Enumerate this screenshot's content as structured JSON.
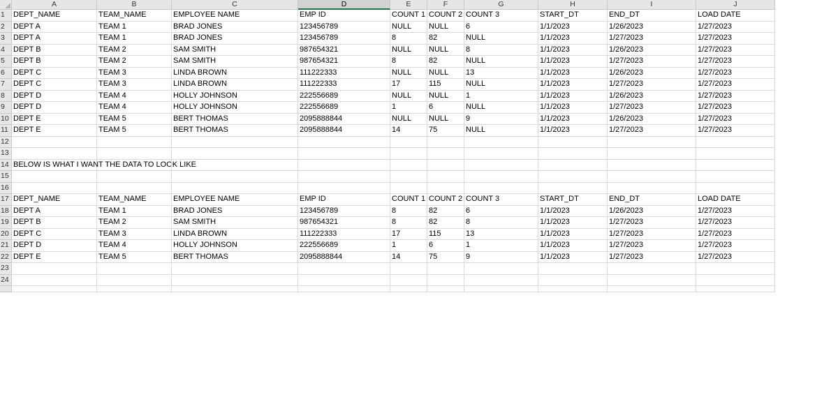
{
  "columns": [
    "A",
    "B",
    "C",
    "D",
    "E",
    "F",
    "G",
    "H",
    "I",
    "J"
  ],
  "selected_column": "D",
  "rows": [
    {
      "n": "1",
      "cells": [
        "DEPT_NAME",
        "TEAM_NAME",
        "EMPLOYEE NAME",
        "EMP ID",
        "COUNT 1",
        "COUNT 2",
        "COUNT 3",
        "START_DT",
        "END_DT",
        "LOAD DATE"
      ]
    },
    {
      "n": "2",
      "cells": [
        "DEPT A",
        "TEAM 1",
        "BRAD JONES",
        "123456789",
        "NULL",
        "NULL",
        "6",
        "1/1/2023",
        "1/26/2023",
        "1/27/2023"
      ]
    },
    {
      "n": "3",
      "cells": [
        "DEPT A",
        "TEAM 1",
        "BRAD JONES",
        "123456789",
        "8",
        "82",
        "NULL",
        "1/1/2023",
        "1/27/2023",
        "1/27/2023"
      ]
    },
    {
      "n": "4",
      "cells": [
        "DEPT B",
        "TEAM 2",
        "SAM SMITH",
        "987654321",
        "NULL",
        "NULL",
        "8",
        "1/1/2023",
        "1/26/2023",
        "1/27/2023"
      ]
    },
    {
      "n": "5",
      "cells": [
        "DEPT B",
        "TEAM 2",
        "SAM SMITH",
        "987654321",
        "8",
        "82",
        "NULL",
        "1/1/2023",
        "1/27/2023",
        "1/27/2023"
      ]
    },
    {
      "n": "6",
      "cells": [
        "DEPT C",
        "TEAM 3",
        "LINDA BROWN",
        "111222333",
        "NULL",
        "NULL",
        "13",
        "1/1/2023",
        "1/26/2023",
        "1/27/2023"
      ]
    },
    {
      "n": "7",
      "cells": [
        "DEPT C",
        "TEAM 3",
        "LINDA BROWN",
        "111222333",
        "17",
        "115",
        "NULL",
        "1/1/2023",
        "1/27/2023",
        "1/27/2023"
      ]
    },
    {
      "n": "8",
      "cells": [
        "DEPT D",
        "TEAM 4",
        "HOLLY JOHNSON",
        "222556689",
        "NULL",
        "NULL",
        "1",
        "1/1/2023",
        "1/26/2023",
        "1/27/2023"
      ]
    },
    {
      "n": "9",
      "cells": [
        "DEPT D",
        "TEAM 4",
        "HOLLY JOHNSON",
        "222556689",
        "1",
        "6",
        "NULL",
        "1/1/2023",
        "1/27/2023",
        "1/27/2023"
      ]
    },
    {
      "n": "10",
      "cells": [
        "DEPT E",
        "TEAM 5",
        "BERT THOMAS",
        "2095888844",
        "NULL",
        "NULL",
        "9",
        "1/1/2023",
        "1/26/2023",
        "1/27/2023"
      ]
    },
    {
      "n": "11",
      "cells": [
        "DEPT E",
        "TEAM 5",
        "BERT THOMAS",
        "2095888844",
        "14",
        "75",
        "NULL",
        "1/1/2023",
        "1/27/2023",
        "1/27/2023"
      ]
    },
    {
      "n": "12",
      "cells": [
        "",
        "",
        "",
        "",
        "",
        "",
        "",
        "",
        "",
        ""
      ]
    },
    {
      "n": "13",
      "cells": [
        "",
        "",
        "",
        "",
        "",
        "",
        "",
        "",
        "",
        ""
      ]
    },
    {
      "n": "14",
      "cells": [
        "BELOW IS WHAT I WANT THE DATA TO LOOK LIKE",
        "",
        "",
        "",
        "",
        "",
        "",
        "",
        "",
        ""
      ]
    },
    {
      "n": "15",
      "cells": [
        "",
        "",
        "",
        "",
        "",
        "",
        "",
        "",
        "",
        ""
      ]
    },
    {
      "n": "16",
      "cells": [
        "",
        "",
        "",
        "",
        "",
        "",
        "",
        "",
        "",
        ""
      ]
    },
    {
      "n": "17",
      "cells": [
        "DEPT_NAME",
        "TEAM_NAME",
        "EMPLOYEE NAME",
        "EMP ID",
        "COUNT 1",
        "COUNT 2",
        "COUNT 3",
        "START_DT",
        "END_DT",
        "LOAD DATE"
      ]
    },
    {
      "n": "18",
      "cells": [
        "DEPT A",
        "TEAM 1",
        "BRAD JONES",
        "123456789",
        "8",
        "82",
        "6",
        "1/1/2023",
        "1/26/2023",
        "1/27/2023"
      ]
    },
    {
      "n": "19",
      "cells": [
        "DEPT B",
        "TEAM 2",
        "SAM SMITH",
        "987654321",
        "8",
        "82",
        "8",
        "1/1/2023",
        "1/27/2023",
        "1/27/2023"
      ]
    },
    {
      "n": "20",
      "cells": [
        "DEPT C",
        "TEAM 3",
        "LINDA BROWN",
        "111222333",
        "17",
        "115",
        "13",
        "1/1/2023",
        "1/27/2023",
        "1/27/2023"
      ]
    },
    {
      "n": "21",
      "cells": [
        "DEPT D",
        "TEAM 4",
        "HOLLY JOHNSON",
        "222556689",
        "1",
        "6",
        "1",
        "1/1/2023",
        "1/27/2023",
        "1/27/2023"
      ]
    },
    {
      "n": "22",
      "cells": [
        "DEPT E",
        "TEAM 5",
        "BERT THOMAS",
        "2095888844",
        "14",
        "75",
        "9",
        "1/1/2023",
        "1/27/2023",
        "1/27/2023"
      ]
    },
    {
      "n": "23",
      "cells": [
        "",
        "",
        "",
        "",
        "",
        "",
        "",
        "",
        "",
        ""
      ]
    },
    {
      "n": "24",
      "cells": [
        "",
        "",
        "",
        "",
        "",
        "",
        "",
        "",
        "",
        ""
      ]
    }
  ]
}
